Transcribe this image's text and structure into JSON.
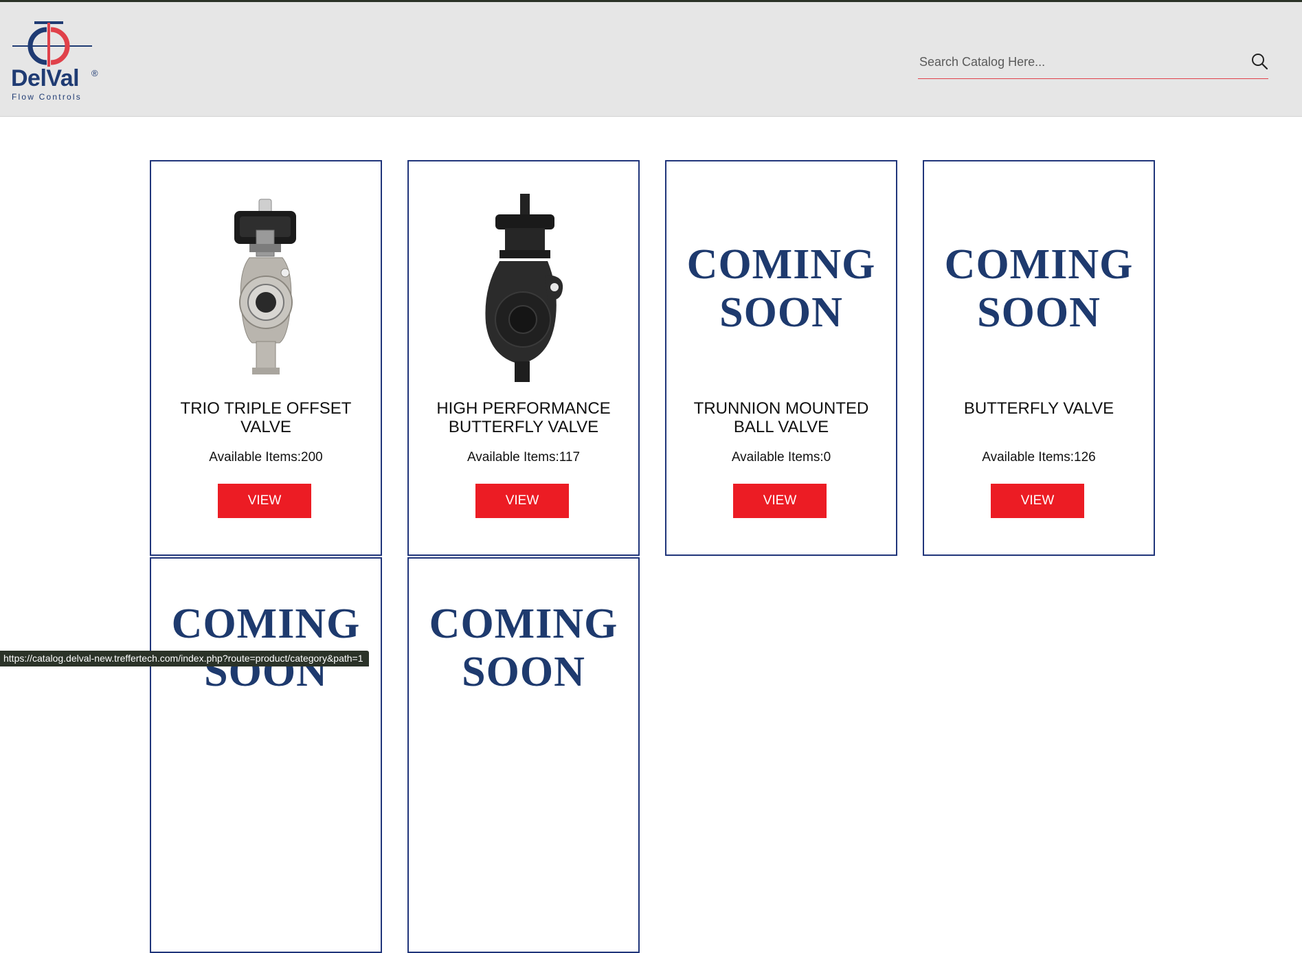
{
  "header": {
    "logo": {
      "name": "DelVal",
      "registered": "®",
      "tagline": "Flow Controls"
    },
    "search": {
      "placeholder": "Search Catalog Here...",
      "icon": "search-icon"
    }
  },
  "colors": {
    "brand_blue": "#1f3b73",
    "brand_red": "#ec1c24",
    "card_border": "#20357a"
  },
  "cards": [
    {
      "title": "TRIO TRIPLE OFFSET VALVE",
      "count": "Available Items:200",
      "button": "VIEW",
      "image": "triple-offset-valve"
    },
    {
      "title": "HIGH PERFORMANCE BUTTERFLY VALVE",
      "count": "Available Items:117",
      "button": "VIEW",
      "image": "butterfly-valve-black"
    },
    {
      "title": "TRUNNION MOUNTED BALL VALVE",
      "count": "Available Items:0",
      "button": "VIEW",
      "image": "coming-soon"
    },
    {
      "title": "BUTTERFLY VALVE",
      "count": "Available Items:126",
      "button": "VIEW",
      "image": "coming-soon"
    },
    {
      "image": "coming-soon"
    },
    {
      "image": "coming-soon"
    }
  ],
  "coming_soon": {
    "line1": "COMING",
    "line2": "SOON"
  },
  "status_bar": {
    "url": "https://catalog.delval-new.treffertech.com/index.php?route=product/category&path=1"
  }
}
